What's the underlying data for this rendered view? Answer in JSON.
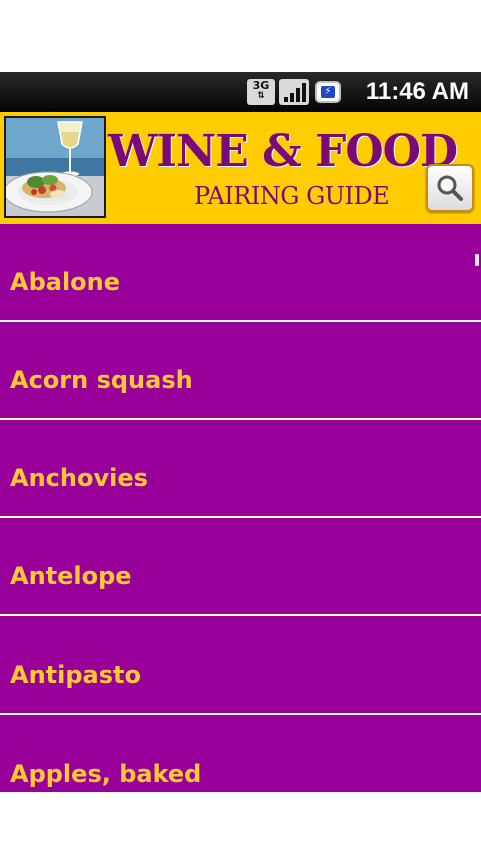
{
  "status_bar": {
    "network_type": "3G",
    "time": "11:46 AM"
  },
  "header": {
    "title": "WINE & FOOD",
    "subtitle": "PAIRING GUIDE",
    "search_icon": "search-icon"
  },
  "list": {
    "items": [
      {
        "label": "Abalone"
      },
      {
        "label": "Acorn squash"
      },
      {
        "label": "Anchovies"
      },
      {
        "label": "Antelope"
      },
      {
        "label": "Antipasto"
      },
      {
        "label": "Apples, baked"
      }
    ]
  },
  "colors": {
    "header_background": "#ffcc00",
    "title": "#7a0a78",
    "list_background": "#990099",
    "item_text": "#ffc933",
    "divider": "#ffffff"
  }
}
